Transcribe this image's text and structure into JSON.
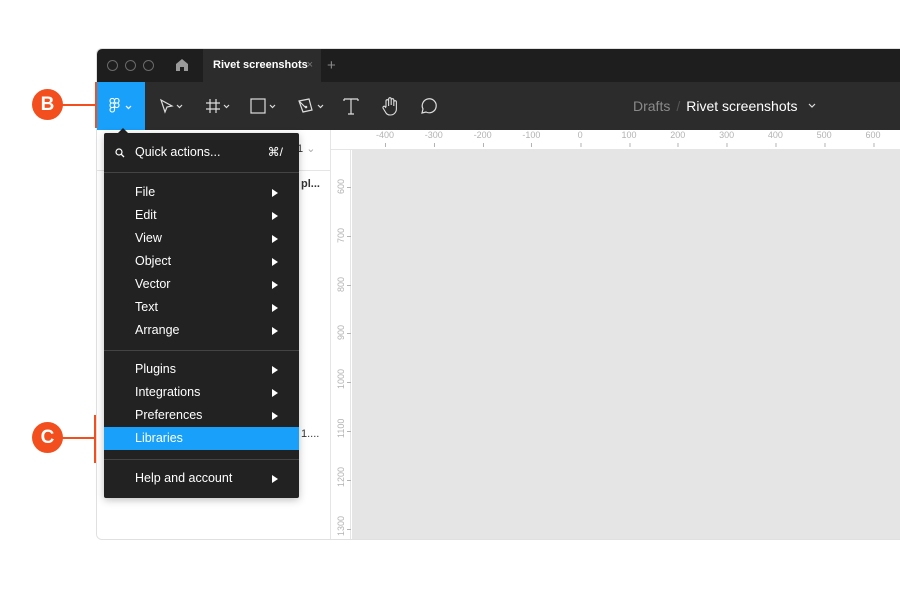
{
  "titlebar": {
    "tab_label": "Rivet screenshots",
    "tab_close": "×",
    "new_tab": "+"
  },
  "toolbar": {
    "tools": [
      "main-menu",
      "move",
      "frame",
      "shape",
      "pen",
      "text",
      "hand",
      "comment"
    ],
    "breadcrumb": {
      "parent": "Drafts",
      "separator": "/",
      "file": "Rivet screenshots"
    }
  },
  "left_panel": {
    "page_indicator": "1",
    "layer_truncated_1": "pl...",
    "layer_truncated_2": "1...."
  },
  "rulers": {
    "top": [
      "-400",
      "-300",
      "-200",
      "-100",
      "0",
      "100",
      "200",
      "300",
      "400",
      "500",
      "600"
    ],
    "left": [
      "600",
      "700",
      "800",
      "900",
      "1000",
      "1100",
      "1200",
      "1300"
    ]
  },
  "menu": {
    "quick_actions": {
      "label": "Quick actions...",
      "shortcut": "⌘/"
    },
    "group1": [
      {
        "label": "File",
        "submenu": true
      },
      {
        "label": "Edit",
        "submenu": true
      },
      {
        "label": "View",
        "submenu": true
      },
      {
        "label": "Object",
        "submenu": true
      },
      {
        "label": "Vector",
        "submenu": true
      },
      {
        "label": "Text",
        "submenu": true
      },
      {
        "label": "Arrange",
        "submenu": true
      }
    ],
    "group2": [
      {
        "label": "Plugins",
        "submenu": true
      },
      {
        "label": "Integrations",
        "submenu": true
      },
      {
        "label": "Preferences",
        "submenu": true
      },
      {
        "label": "Libraries",
        "submenu": false,
        "active": true
      }
    ],
    "group3": [
      {
        "label": "Help and account",
        "submenu": true
      }
    ]
  },
  "callouts": {
    "b": "B",
    "c": "C"
  },
  "colors": {
    "accent": "#18a0fb",
    "callout": "#f24e1e",
    "menu_bg": "#222222",
    "toolbar_bg": "#2c2c2c"
  }
}
